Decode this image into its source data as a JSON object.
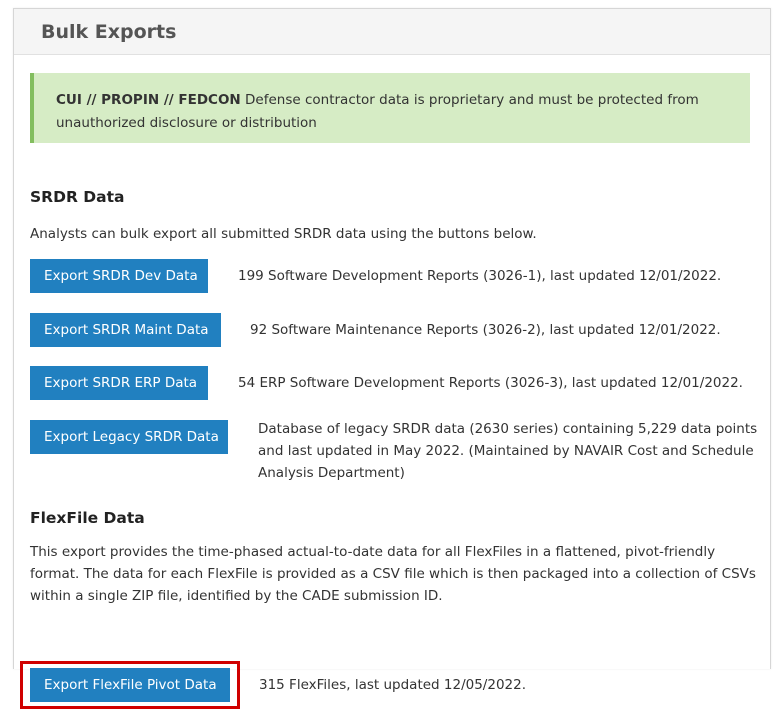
{
  "panel": {
    "title": "Bulk Exports"
  },
  "alert": {
    "marking": "CUI // PROPIN // FEDCON",
    "text": " Defense contractor data is proprietary and must be protected from unauthorized disclosure or distribution"
  },
  "srdr": {
    "heading": "SRDR Data",
    "description": "Analysts can bulk export all submitted SRDR data using the buttons below.",
    "exports": [
      {
        "button": "Export SRDR Dev Data",
        "info": "199 Software Development Reports (3026-1), last updated 12/01/2022."
      },
      {
        "button": "Export SRDR Maint Data",
        "info": "92 Software Maintenance Reports (3026-2), last updated 12/01/2022."
      },
      {
        "button": "Export SRDR ERP Data",
        "info": "54 ERP Software Development Reports (3026-3), last updated 12/01/2022."
      },
      {
        "button": "Export Legacy SRDR Data",
        "info": "Database of legacy SRDR data (2630 series) containing 5,229 data points and last updated in May 2022. (Maintained by NAVAIR Cost and Schedule Analysis Department)"
      }
    ]
  },
  "flexfile": {
    "heading": "FlexFile Data",
    "description": "This export provides the time-phased actual-to-date data for all FlexFiles in a flattened, pivot-friendly format. The data for each FlexFile is provided as a CSV file which is then packaged into a collection of CSVs within a single ZIP file, identified by the CADE submission ID.",
    "button": "Export FlexFile Pivot Data",
    "info": "315 FlexFiles, last updated 12/05/2022."
  },
  "colors": {
    "button": "#2180c0",
    "alert_bg": "#d6ecc5",
    "alert_border": "#83be5f",
    "highlight": "#d00000"
  }
}
